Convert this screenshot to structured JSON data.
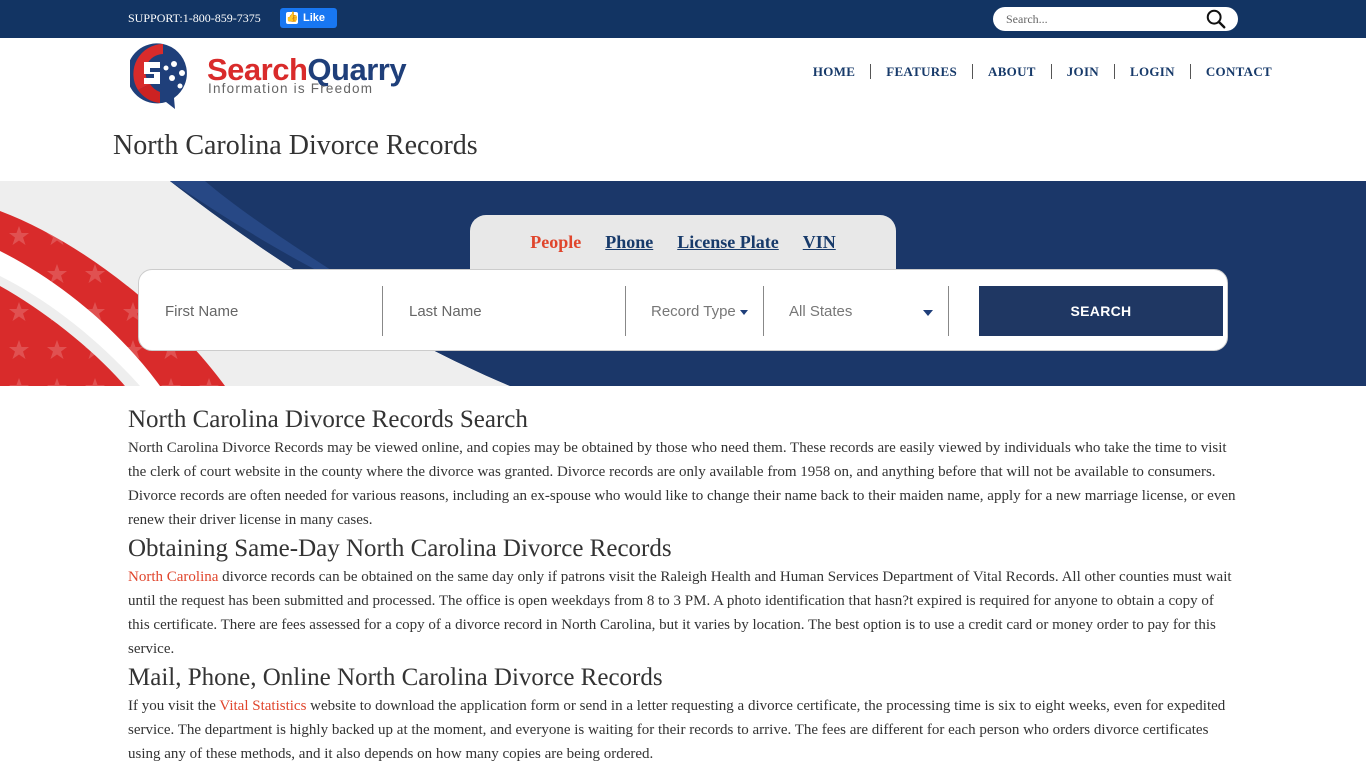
{
  "topbar": {
    "support": "SUPPORT:1-800-859-7375",
    "like_label": "Like",
    "search_placeholder": "Search..."
  },
  "logo": {
    "word_part1": "Search",
    "word_part2": "Quarry",
    "tagline": "Information is Freedom"
  },
  "nav": [
    "HOME",
    "FEATURES",
    "ABOUT",
    "JOIN",
    "LOGIN",
    "CONTACT"
  ],
  "page_title": "North Carolina Divorce Records",
  "search": {
    "tabs": [
      "People",
      "Phone",
      "License Plate",
      "VIN"
    ],
    "active_tab": "People",
    "first_name_placeholder": "First Name",
    "last_name_placeholder": "Last Name",
    "record_type": "Record Type",
    "state": "All States",
    "button": "SEARCH"
  },
  "content": {
    "h1": "North Carolina Divorce Records Search",
    "p1": "North Carolina Divorce Records may be viewed online, and copies may be obtained by those who need them. These records are easily viewed by individuals who take the time to visit the clerk of court website in the county where the divorce was granted. Divorce records are only available from 1958 on, and anything before that will not be available to consumers. Divorce records are often needed for various reasons, including an ex-spouse who would like to change their name back to their maiden name, apply for a new marriage license, or even renew their driver license in many cases.",
    "h2": "Obtaining Same-Day North Carolina Divorce Records",
    "p2_link": "North Carolina",
    "p2_rest": " divorce records can be obtained on the same day only if patrons visit the Raleigh Health and Human Services Department of Vital Records. All other counties must wait until the request has been submitted and processed. The office is open weekdays from 8 to 3 PM. A photo identification that hasn?t expired is required for anyone to obtain a copy of this certificate. There are fees assessed for a copy of a divorce record in North Carolina, but it varies by location. The best option is to use a credit card or money order to pay for this service.",
    "h3": "Mail, Phone, Online North Carolina Divorce Records",
    "p3_pre": "If you visit the ",
    "p3_link": "Vital Statistics",
    "p3_rest": " website to download the application form or send in a letter requesting a divorce certificate, the processing time is six to eight weeks, even for expedited service. The department is highly backed up at the moment, and everyone is waiting for their records to arrive. The fees are different for each person who orders divorce certificates using any of these methods, and it also depends on how many copies are being ordered."
  },
  "colors": {
    "navy": "#123463",
    "accent": "#e0452c",
    "button": "#1f3763"
  }
}
